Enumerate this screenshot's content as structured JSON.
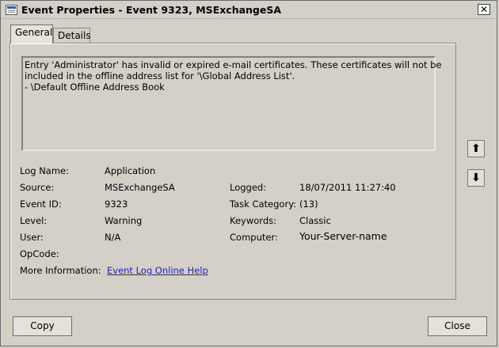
{
  "window": {
    "title": "Event Properties - Event 9323, MSExchangeSA",
    "close_glyph": "✕"
  },
  "tabs": [
    {
      "label": "General",
      "active": true
    },
    {
      "label": "Details",
      "active": false
    }
  ],
  "description": {
    "lines": [
      "Entry 'Administrator' has invalid or expired e-mail certificates.  These certificates will not be",
      "included in the offline address list for '\\Global Address List'.",
      "- \\Default Offline Address Book"
    ]
  },
  "fields_left": [
    {
      "label": "Log Name:",
      "value": "Application"
    },
    {
      "label": "Source:",
      "value": "MSExchangeSA"
    },
    {
      "label": "Event ID:",
      "value": "9323"
    },
    {
      "label": "Level:",
      "value": "Warning"
    },
    {
      "label": "User:",
      "value": "N/A"
    },
    {
      "label": "OpCode:",
      "value": ""
    },
    {
      "label": "More Information:",
      "value": "Event Log Online Help"
    }
  ],
  "fields_right": [
    {
      "label": "Logged:",
      "value": "18/07/2011 11:27:40"
    },
    {
      "label": "Task Category:",
      "value": "(13)"
    },
    {
      "label": "Keywords:",
      "value": "Classic"
    },
    {
      "label": "Computer:",
      "value": "Your-Server-name"
    }
  ],
  "side_buttons": {
    "up_icon": "arrow-up-icon",
    "up_glyph": "⬆",
    "down_icon": "arrow-down-icon",
    "down_glyph": "⬇"
  },
  "buttons": {
    "copy_label": "Copy",
    "close_label": "Close"
  }
}
